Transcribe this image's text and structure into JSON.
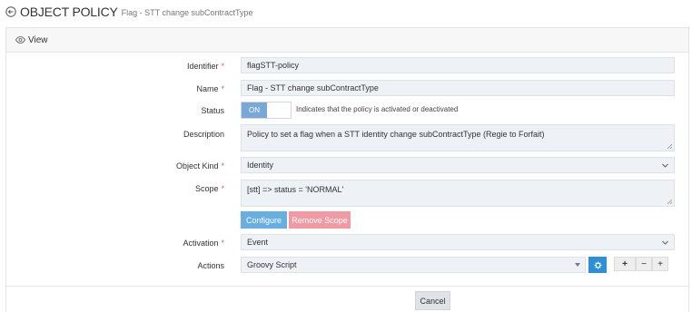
{
  "header": {
    "title": "OBJECT POLICY",
    "subtitle": "Flag - STT change subContractType"
  },
  "panel": {
    "view_label": "View"
  },
  "form": {
    "identifier": {
      "label": "Identifier",
      "required": "*",
      "value": "flagSTT-policy"
    },
    "name": {
      "label": "Name",
      "required": "*",
      "value": "Flag - STT change subContractType"
    },
    "status": {
      "label": "Status",
      "toggle_label": "ON",
      "hint": "Indicates that the policy is activated or deactivated"
    },
    "description": {
      "label": "Description",
      "value": "Policy to set a flag when a STT identity change subContractType (Regie to Forfait)"
    },
    "object_kind": {
      "label": "Object Kind",
      "required": "*",
      "value": "Identity"
    },
    "scope": {
      "label": "Scope",
      "required": "*",
      "value": "[stt] => status = 'NORMAL'",
      "configure_label": "Configure",
      "remove_label": "Remove Scope"
    },
    "activation": {
      "label": "Activation",
      "required": "*",
      "value": "Event"
    },
    "actions": {
      "label": "Actions",
      "value": "Groovy Script",
      "add_label": "+",
      "minus_label": "−",
      "plus_label": "+"
    }
  },
  "footer": {
    "cancel_label": "Cancel"
  },
  "colors": {
    "accent": "#2f8fd6",
    "configure": "#68aee0",
    "remove": "#f09aa3",
    "required": "#e05c6a",
    "toggle_on": "#7aa7d6"
  }
}
